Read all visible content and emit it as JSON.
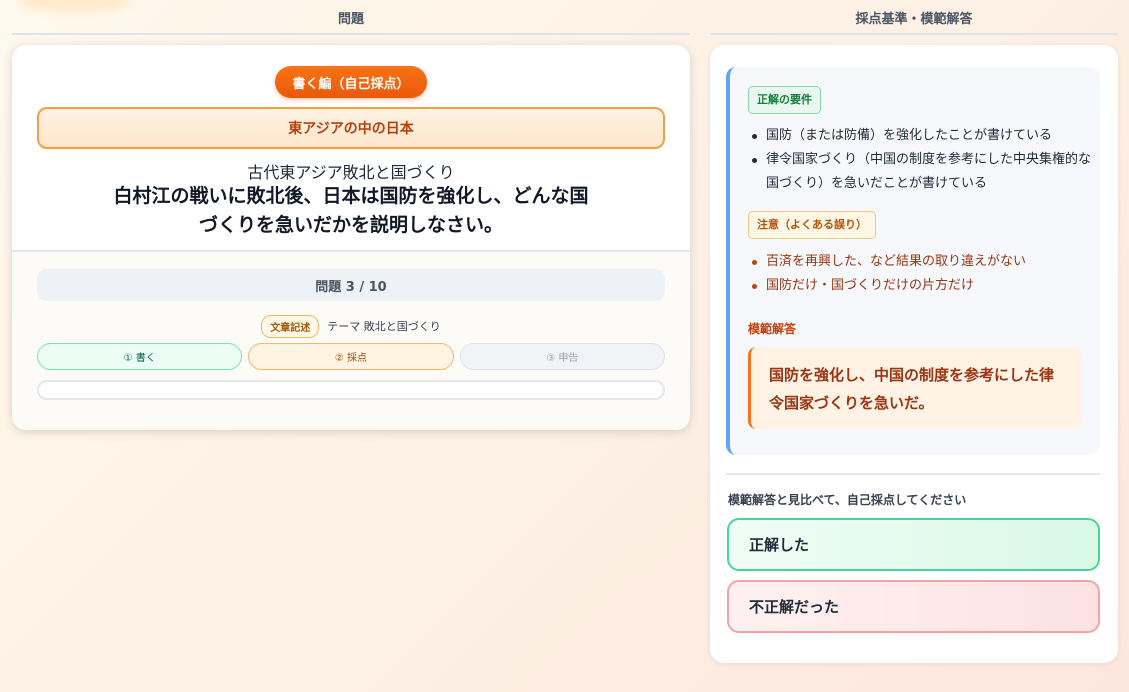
{
  "columns": {
    "left_header": "問題",
    "right_header": "採点基準・模範解答"
  },
  "question": {
    "mode": "書く編（自己採点）",
    "unit": "東アジアの中の日本",
    "subtitle": "古代東アジア敗北と国づくり",
    "text": "白村江の戦いに敗北後、日本は国防を強化し、どんな国づくりを急いだかを説明しなさい。",
    "progress": "問題 3 / 10",
    "type_badge": "文章記述",
    "theme": "テーマ 敗北と国づくり",
    "steps": [
      "① 書く",
      "② 採点",
      "③ 申告"
    ],
    "answer_value": ""
  },
  "criteria": {
    "requirements_label": "正解の要件",
    "requirements": [
      "国防（または防備）を強化したことが書けている",
      "律令国家づくり（中国の制度を参考にした中央集権的な国づくり）を急いだことが書けている"
    ],
    "cautions_label": "注意（よくある誤り）",
    "cautions": [
      "百済を再興した、など結果の取り違えがない",
      "国防だけ・国づくりだけの片方だけ"
    ],
    "model_label": "模範解答",
    "model_answer": "国防を強化し、中国の制度を参考にした律令国家づくりを急いだ。"
  },
  "grading": {
    "instruction": "模範解答と見比べて、自己採点してください",
    "correct_label": "正解した",
    "wrong_label": "不正解だった"
  },
  "colors": {
    "accent_orange": "#ea580c",
    "correct_green": "#4ad49a",
    "wrong_red": "#f3a3a8",
    "criteria_border": "#60a5fa"
  }
}
